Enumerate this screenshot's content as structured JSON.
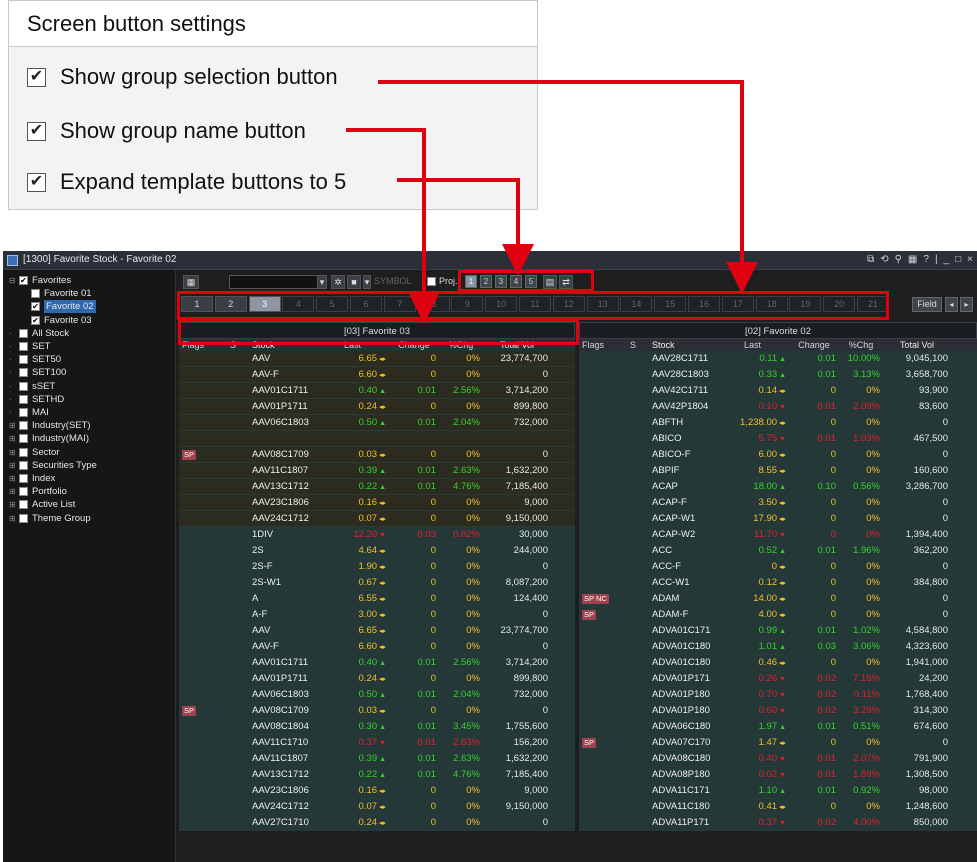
{
  "settings": {
    "title": "Screen button settings",
    "options": [
      {
        "label": "Show group selection button",
        "checked": true
      },
      {
        "label": "Show group name button",
        "checked": true
      },
      {
        "label": "Expand template buttons to 5",
        "checked": true
      }
    ]
  },
  "window": {
    "title": "[1300] Favorite Stock - Favorite 02",
    "controls": [
      "⧉",
      "⟲",
      "⚲",
      "▦",
      "?",
      "|",
      "_",
      "□",
      "×"
    ]
  },
  "tree": [
    {
      "label": "Favorites",
      "checked": true,
      "indent": 0,
      "expand": "⊟"
    },
    {
      "label": "Favorite 01",
      "checked": false,
      "indent": 1
    },
    {
      "label": "Favorite 02",
      "checked": true,
      "indent": 1,
      "selected": true
    },
    {
      "label": "Favorite 03",
      "checked": true,
      "indent": 1
    },
    {
      "label": "All Stock",
      "checked": false,
      "indent": 0,
      "expand": ""
    },
    {
      "label": "SET",
      "checked": false,
      "indent": 0,
      "expand": ""
    },
    {
      "label": "SET50",
      "checked": false,
      "indent": 0,
      "expand": ""
    },
    {
      "label": "SET100",
      "checked": false,
      "indent": 0,
      "expand": ""
    },
    {
      "label": "sSET",
      "checked": false,
      "indent": 0,
      "expand": ""
    },
    {
      "label": "SETHD",
      "checked": false,
      "indent": 0,
      "expand": ""
    },
    {
      "label": "MAI",
      "checked": false,
      "indent": 0,
      "expand": ""
    },
    {
      "label": "Industry(SET)",
      "checked": false,
      "indent": 0,
      "expand": "⊞"
    },
    {
      "label": "Industry(MAI)",
      "checked": false,
      "indent": 0,
      "expand": "⊞"
    },
    {
      "label": "Sector",
      "checked": false,
      "indent": 0,
      "expand": "⊞"
    },
    {
      "label": "Securities Type",
      "checked": false,
      "indent": 0,
      "expand": "⊞"
    },
    {
      "label": "Index",
      "checked": false,
      "indent": 0,
      "expand": "⊞"
    },
    {
      "label": "Portfolio",
      "checked": false,
      "indent": 0,
      "expand": "⊞"
    },
    {
      "label": "Active List",
      "checked": false,
      "indent": 0,
      "expand": "⊞"
    },
    {
      "label": "Theme Group",
      "checked": false,
      "indent": 0,
      "expand": "⊞"
    }
  ],
  "toolbar": {
    "symbol_placeholder": "SYMBOL",
    "proj_label": "Proj.",
    "template_buttons": [
      "1",
      "2",
      "3",
      "4",
      "5"
    ],
    "active_template": "1"
  },
  "groups": [
    "1",
    "2",
    "3",
    "4",
    "5",
    "6",
    "7",
    "8",
    "9",
    "10",
    "11",
    "12",
    "13",
    "14",
    "15",
    "16",
    "17",
    "18",
    "19",
    "20",
    "21"
  ],
  "group_selected": [
    "1",
    "2",
    "3"
  ],
  "field_label": "Field",
  "columns": [
    "Flags",
    "S",
    "Stock",
    "Last",
    "Change",
    "%Chg",
    "Total Vol"
  ],
  "panels": [
    {
      "title": "[03] Favorite 03",
      "rows": [
        {
          "flags": "",
          "stock": "AAV",
          "last": "6.65",
          "dir": "eq",
          "chg": "0",
          "pct": "0%",
          "vol": "23,774,700"
        },
        {
          "flags": "",
          "stock": "AAV-F",
          "last": "6.60",
          "dir": "eq",
          "chg": "0",
          "pct": "0%",
          "vol": "0"
        },
        {
          "flags": "",
          "stock": "AAV01C1711",
          "last": "0.40",
          "dir": "up",
          "chg": "0.01",
          "pct": "2.56%",
          "vol": "3,714,200"
        },
        {
          "flags": "",
          "stock": "AAV01P1711",
          "last": "0.24",
          "dir": "eq",
          "chg": "0",
          "pct": "0%",
          "vol": "899,800"
        },
        {
          "flags": "",
          "stock": "AAV06C1803",
          "last": "0.50",
          "dir": "up",
          "chg": "0.01",
          "pct": "2.04%",
          "vol": "732,000"
        },
        {
          "flags": "",
          "stock": "",
          "last": "",
          "dir": "",
          "chg": "",
          "pct": "",
          "vol": ""
        },
        {
          "flags": "SP",
          "stock": "AAV08C1709",
          "last": "0.03",
          "dir": "eq",
          "chg": "0",
          "pct": "0%",
          "vol": "0"
        },
        {
          "flags": "",
          "stock": "AAV11C1807",
          "last": "0.39",
          "dir": "up",
          "chg": "0.01",
          "pct": "2.63%",
          "vol": "1,632,200"
        },
        {
          "flags": "",
          "stock": "AAV13C1712",
          "last": "0.22",
          "dir": "up",
          "chg": "0.01",
          "pct": "4.76%",
          "vol": "7,185,400"
        },
        {
          "flags": "",
          "stock": "AAV23C1806",
          "last": "0.16",
          "dir": "eq",
          "chg": "0",
          "pct": "0%",
          "vol": "9,000"
        },
        {
          "flags": "",
          "stock": "AAV24C1712",
          "last": "0.07",
          "dir": "eq",
          "chg": "0",
          "pct": "0%",
          "vol": "9,150,000"
        },
        {
          "flags": "",
          "stock": "1DIV",
          "last": "12.20",
          "dir": "down",
          "chg": "0.03",
          "pct": "0.02%",
          "vol": "30,000"
        },
        {
          "flags": "",
          "stock": "2S",
          "last": "4.64",
          "dir": "eq",
          "chg": "0",
          "pct": "0%",
          "vol": "244,000"
        },
        {
          "flags": "",
          "stock": "2S-F",
          "last": "1.90",
          "dir": "eq",
          "chg": "0",
          "pct": "0%",
          "vol": "0"
        },
        {
          "flags": "",
          "stock": "2S-W1",
          "last": "0.67",
          "dir": "eq",
          "chg": "0",
          "pct": "0%",
          "vol": "8,087,200"
        },
        {
          "flags": "",
          "stock": "A",
          "last": "6.55",
          "dir": "eq",
          "chg": "0",
          "pct": "0%",
          "vol": "124,400"
        },
        {
          "flags": "",
          "stock": "A-F",
          "last": "3.00",
          "dir": "eq",
          "chg": "0",
          "pct": "0%",
          "vol": "0"
        },
        {
          "flags": "",
          "stock": "AAV",
          "last": "6.65",
          "dir": "eq",
          "chg": "0",
          "pct": "0%",
          "vol": "23,774,700"
        },
        {
          "flags": "",
          "stock": "AAV-F",
          "last": "6.60",
          "dir": "eq",
          "chg": "0",
          "pct": "0%",
          "vol": "0"
        },
        {
          "flags": "",
          "stock": "AAV01C1711",
          "last": "0.40",
          "dir": "up",
          "chg": "0.01",
          "pct": "2.56%",
          "vol": "3,714,200"
        },
        {
          "flags": "",
          "stock": "AAV01P1711",
          "last": "0.24",
          "dir": "eq",
          "chg": "0",
          "pct": "0%",
          "vol": "899,800"
        },
        {
          "flags": "",
          "stock": "AAV06C1803",
          "last": "0.50",
          "dir": "up",
          "chg": "0.01",
          "pct": "2.04%",
          "vol": "732,000"
        },
        {
          "flags": "SP",
          "stock": "AAV08C1709",
          "last": "0.03",
          "dir": "eq",
          "chg": "0",
          "pct": "0%",
          "vol": "0"
        },
        {
          "flags": "",
          "stock": "AAV08C1804",
          "last": "0.30",
          "dir": "up",
          "chg": "0.01",
          "pct": "3.45%",
          "vol": "1,755,600"
        },
        {
          "flags": "",
          "stock": "AAV11C1710",
          "last": "0.37",
          "dir": "down",
          "chg": "0.01",
          "pct": "2.63%",
          "vol": "156,200"
        },
        {
          "flags": "",
          "stock": "AAV11C1807",
          "last": "0.39",
          "dir": "up",
          "chg": "0.01",
          "pct": "2.63%",
          "vol": "1,632,200"
        },
        {
          "flags": "",
          "stock": "AAV13C1712",
          "last": "0.22",
          "dir": "up",
          "chg": "0.01",
          "pct": "4.76%",
          "vol": "7,185,400"
        },
        {
          "flags": "",
          "stock": "AAV23C1806",
          "last": "0.16",
          "dir": "eq",
          "chg": "0",
          "pct": "0%",
          "vol": "9,000"
        },
        {
          "flags": "",
          "stock": "AAV24C1712",
          "last": "0.07",
          "dir": "eq",
          "chg": "0",
          "pct": "0%",
          "vol": "9,150,000"
        },
        {
          "flags": "",
          "stock": "AAV27C1710",
          "last": "0.24",
          "dir": "eq",
          "chg": "0",
          "pct": "0%",
          "vol": "0"
        }
      ]
    },
    {
      "title": "[02] Favorite 02",
      "rows": [
        {
          "flags": "",
          "stock": "AAV28C1711",
          "last": "0.11",
          "dir": "up",
          "chg": "0.01",
          "pct": "10.00%",
          "vol": "9,045,100"
        },
        {
          "flags": "",
          "stock": "AAV28C1803",
          "last": "0.33",
          "dir": "up",
          "chg": "0.01",
          "pct": "3.13%",
          "vol": "3,658,700"
        },
        {
          "flags": "",
          "stock": "AAV42C1711",
          "last": "0.14",
          "dir": "eq",
          "chg": "0",
          "pct": "0%",
          "vol": "93,900"
        },
        {
          "flags": "",
          "stock": "AAV42P1804",
          "last": "0.10",
          "dir": "down",
          "chg": "0.01",
          "pct": "2.09%",
          "vol": "83,600"
        },
        {
          "flags": "",
          "stock": "ABFTH",
          "last": "1,238.00",
          "dir": "eq",
          "chg": "0",
          "pct": "0%",
          "vol": "0"
        },
        {
          "flags": "",
          "stock": "ABICO",
          "last": "5.75",
          "dir": "down",
          "chg": "0.01",
          "pct": "1.03%",
          "vol": "467,500"
        },
        {
          "flags": "",
          "stock": "ABICO-F",
          "last": "6.00",
          "dir": "eq",
          "chg": "0",
          "pct": "0%",
          "vol": "0"
        },
        {
          "flags": "",
          "stock": "ABPIF",
          "last": "8.55",
          "dir": "eq",
          "chg": "0",
          "pct": "0%",
          "vol": "160,600"
        },
        {
          "flags": "",
          "stock": "ACAP",
          "last": "18.00",
          "dir": "up",
          "chg": "0.10",
          "pct": "0.56%",
          "vol": "3,286,700"
        },
        {
          "flags": "",
          "stock": "ACAP-F",
          "last": "3.50",
          "dir": "eq",
          "chg": "0",
          "pct": "0%",
          "vol": "0"
        },
        {
          "flags": "",
          "stock": "ACAP-W1",
          "last": "17.90",
          "dir": "eq",
          "chg": "0",
          "pct": "0%",
          "vol": "0"
        },
        {
          "flags": "",
          "stock": "ACAP-W2",
          "last": "11.70",
          "dir": "down",
          "chg": "0",
          "pct": "0%",
          "vol": "1,394,400"
        },
        {
          "flags": "",
          "stock": "ACC",
          "last": "0.52",
          "dir": "up",
          "chg": "0.01",
          "pct": "1.96%",
          "vol": "362,200"
        },
        {
          "flags": "",
          "stock": "ACC-F",
          "last": "0",
          "dir": "eq",
          "chg": "0",
          "pct": "0%",
          "vol": "0"
        },
        {
          "flags": "",
          "stock": "ACC-W1",
          "last": "0.12",
          "dir": "eq",
          "chg": "0",
          "pct": "0%",
          "vol": "384,800"
        },
        {
          "flags": "SP NC",
          "stock": "ADAM",
          "last": "14.00",
          "dir": "eq",
          "chg": "0",
          "pct": "0%",
          "vol": "0"
        },
        {
          "flags": "SP",
          "stock": "ADAM-F",
          "last": "4.00",
          "dir": "eq",
          "chg": "0",
          "pct": "0%",
          "vol": "0"
        },
        {
          "flags": "",
          "stock": "ADVA01C171",
          "last": "0.99",
          "dir": "up",
          "chg": "0.01",
          "pct": "1.02%",
          "vol": "4,584,800"
        },
        {
          "flags": "",
          "stock": "ADVA01C180",
          "last": "1.01",
          "dir": "up",
          "chg": "0.03",
          "pct": "3.06%",
          "vol": "4,323,600"
        },
        {
          "flags": "",
          "stock": "ADVA01C180",
          "last": "0.46",
          "dir": "eq",
          "chg": "0",
          "pct": "0%",
          "vol": "1,941,000"
        },
        {
          "flags": "",
          "stock": "ADVA01P171",
          "last": "0.26",
          "dir": "down",
          "chg": "0.02",
          "pct": "7.15%",
          "vol": "24,200"
        },
        {
          "flags": "",
          "stock": "ADVA01P180",
          "last": "0.70",
          "dir": "down",
          "chg": "0.02",
          "pct": "0.11%",
          "vol": "1,768,400"
        },
        {
          "flags": "",
          "stock": "ADVA01P180",
          "last": "0.60",
          "dir": "down",
          "chg": "0.02",
          "pct": "3.29%",
          "vol": "314,300"
        },
        {
          "flags": "",
          "stock": "ADVA06C180",
          "last": "1.97",
          "dir": "up",
          "chg": "0.01",
          "pct": "0.51%",
          "vol": "674,600"
        },
        {
          "flags": "SP",
          "stock": "ADVA07C170",
          "last": "1.47",
          "dir": "eq",
          "chg": "0",
          "pct": "0%",
          "vol": "0"
        },
        {
          "flags": "",
          "stock": "ADVA08C180",
          "last": "0.40",
          "dir": "down",
          "chg": "0.01",
          "pct": "2.07%",
          "vol": "791,900"
        },
        {
          "flags": "",
          "stock": "ADVA08P180",
          "last": "0.02",
          "dir": "down",
          "chg": "0.01",
          "pct": "1.89%",
          "vol": "1,308,500"
        },
        {
          "flags": "",
          "stock": "ADVA11C171",
          "last": "1.10",
          "dir": "up",
          "chg": "0.01",
          "pct": "0.92%",
          "vol": "98,000"
        },
        {
          "flags": "",
          "stock": "ADVA11C180",
          "last": "0.41",
          "dir": "eq",
          "chg": "0",
          "pct": "0%",
          "vol": "1,248,600"
        },
        {
          "flags": "",
          "stock": "ADVA11P171",
          "last": "0.37",
          "dir": "down",
          "chg": "0.02",
          "pct": "4.00%",
          "vol": "850,000"
        }
      ]
    }
  ],
  "colors": {
    "up": "#39d12f",
    "down": "#e0202a",
    "eq": "#f2c12e",
    "annotation": "#e0000f"
  }
}
